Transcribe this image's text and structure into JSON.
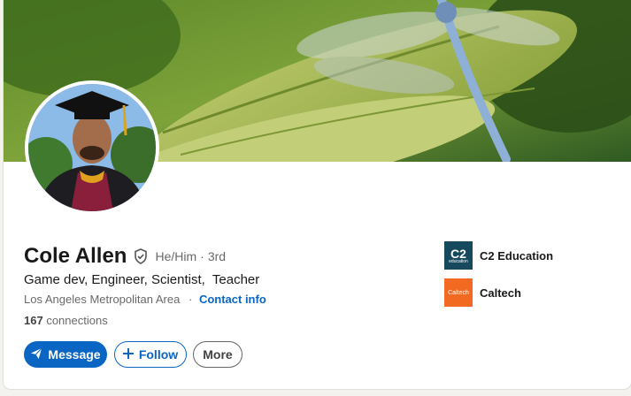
{
  "profile": {
    "name": "Cole Allen",
    "pronouns": "He/Him",
    "separator": "·",
    "degree": "3rd",
    "headline": "Game dev, Engineer, Scientist,  Teacher",
    "location": "Los Angeles Metropolitan Area",
    "location_separator": "·",
    "contact_info": "Contact info",
    "connections_count": "167",
    "connections_label": "connections"
  },
  "actions": {
    "message": "Message",
    "follow": "Follow",
    "more": "More"
  },
  "organizations": [
    {
      "name": "C2 Education",
      "logo_text": "C2",
      "logo_subtext": "education",
      "logo_color": "#16495e"
    },
    {
      "name": "Caltech",
      "logo_text": "Caltech",
      "logo_color": "#f26a21"
    }
  ],
  "colors": {
    "accent": "#0a66c2",
    "page_background": "#f3f2ef"
  },
  "icons": {
    "verified": "verified-shield-icon",
    "message": "paper-plane-icon",
    "follow": "plus-icon"
  }
}
